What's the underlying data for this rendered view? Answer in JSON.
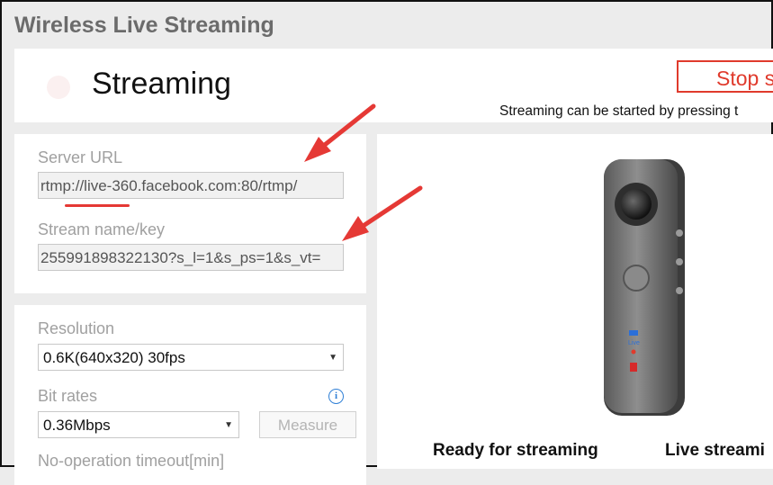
{
  "app": {
    "title": "Wireless Live Streaming"
  },
  "status": {
    "title": "Streaming",
    "stop_label": "Stop s",
    "hint": "Streaming can be started by pressing t"
  },
  "server": {
    "url_label": "Server URL",
    "url_value": "rtmp://live-360.facebook.com:80/rtmp/",
    "key_label": "Stream name/key",
    "key_value": "255991898322130?s_l=1&s_ps=1&s_vt="
  },
  "settings": {
    "resolution_label": "Resolution",
    "resolution_value": "0.6K(640x320) 30fps",
    "bitrate_label": "Bit rates",
    "bitrate_value": "0.36Mbps",
    "measure_label": "Measure",
    "timeout_label": "No-operation timeout[min]"
  },
  "preview": {
    "step1": "Ready for streaming",
    "step2": "Live streami",
    "camera_live_text": "Live"
  },
  "icons": {
    "status_dot": "status-indicator-icon",
    "info": "info-icon",
    "caret": "chevron-down-icon"
  },
  "colors": {
    "accent": "#e03a2c",
    "annotation_arrow": "#e53935",
    "info": "#2f7fd6"
  }
}
